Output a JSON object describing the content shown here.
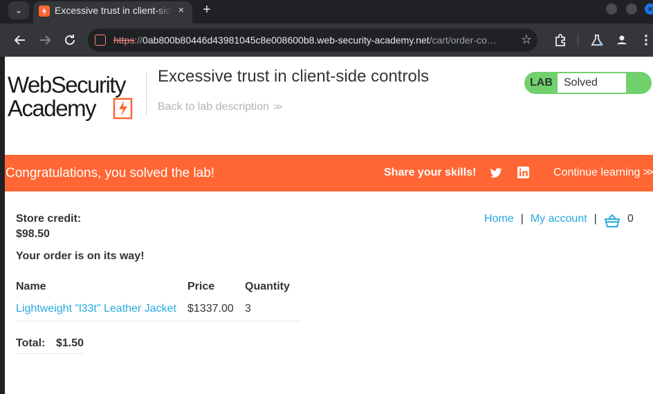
{
  "browser": {
    "tab_title": "Excessive trust in client-side controls",
    "tab_close": "×",
    "new_tab": "+",
    "url_scheme": "https",
    "url_sep": "://",
    "url_host": "0ab800b80446d43981045c8e008600b8.web-security-academy.net",
    "url_path": "/cart/order-co…"
  },
  "header": {
    "logo_line1": "WebSecurity",
    "logo_line2": "Academy",
    "lab_title": "Excessive trust in client-side controls",
    "back_link": "Back to lab description",
    "lab_badge_label": "LAB",
    "lab_status": "Solved",
    "status_color": "#70d16d"
  },
  "banner": {
    "message": "Congratulations, you solved the lab!",
    "share_label": "Share your skills!",
    "continue_label": "Continue learning",
    "color": "#ff6633"
  },
  "account": {
    "store_credit_label": "Store credit:",
    "store_credit_value": "$98.50",
    "order_message": "Your order is on its way!"
  },
  "nav": {
    "home": "Home",
    "my_account": "My account",
    "separator": "|",
    "cart_count": "0"
  },
  "order": {
    "columns": [
      "Name",
      "Price",
      "Quantity"
    ],
    "rows": [
      {
        "name": "Lightweight \"l33t\" Leather Jacket",
        "price": "$1337.00",
        "quantity": "3"
      }
    ],
    "total_label": "Total:",
    "total_value": "$1.50"
  }
}
